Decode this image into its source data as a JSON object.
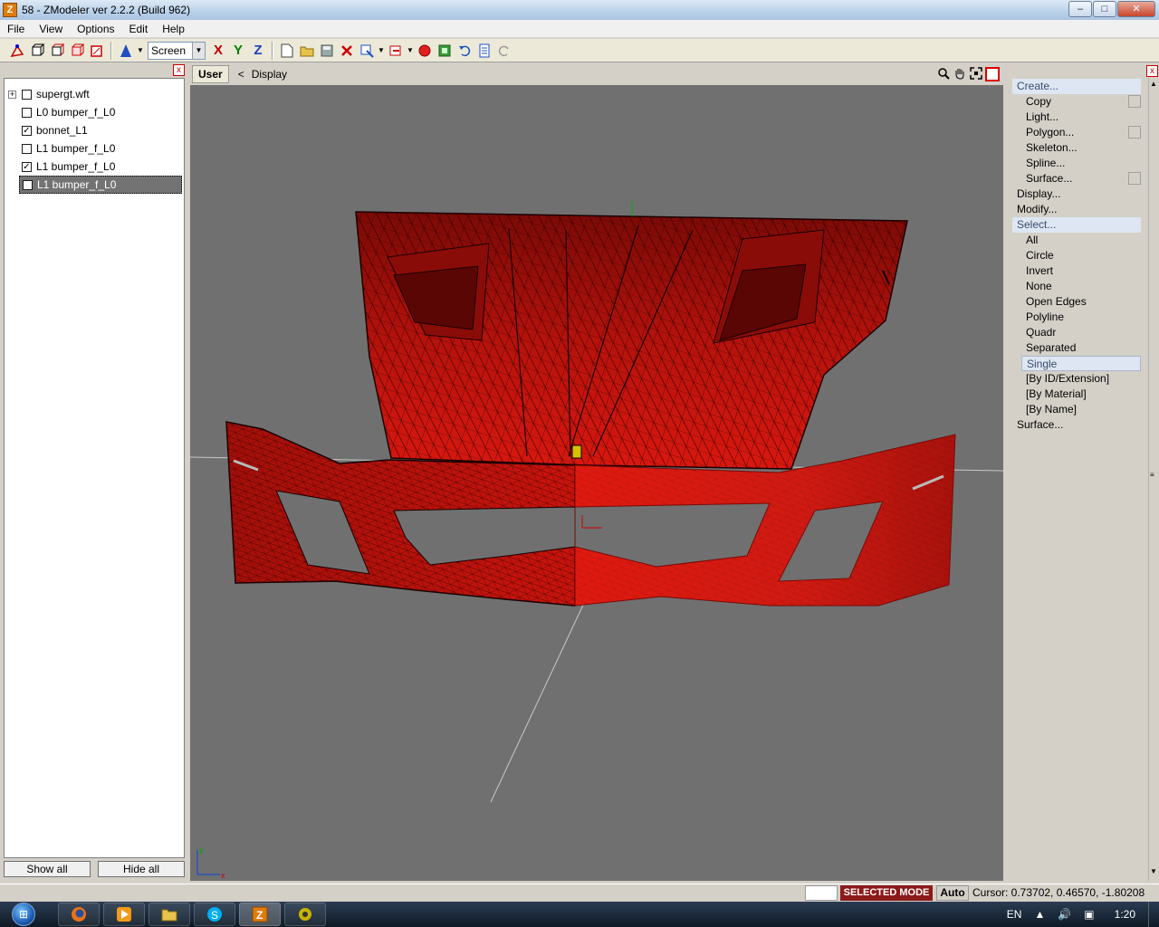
{
  "window": {
    "title": "58 - ZModeler ver 2.2.2 (Build 962)",
    "icon_letter": "Z",
    "controls": {
      "minimize": "–",
      "maximize": "□",
      "close": "✕"
    }
  },
  "menu": [
    {
      "label": "File"
    },
    {
      "label": "View"
    },
    {
      "label": "Options"
    },
    {
      "label": "Edit"
    },
    {
      "label": "Help"
    }
  ],
  "toolbar": {
    "mode_select": "Screen",
    "axis_x": "X",
    "axis_y": "Y",
    "axis_z": "Z"
  },
  "left_panel": {
    "close": "x",
    "items": [
      {
        "label": "supergt.wft",
        "expander": "+",
        "checked": false
      },
      {
        "label": "L0 bumper_f_L0",
        "checked": false
      },
      {
        "label": "bonnet_L1",
        "checked": true
      },
      {
        "label": "L1 bumper_f_L0",
        "checked": false
      },
      {
        "label": "L1 bumper_f_L0",
        "checked": true
      },
      {
        "label": "L1 bumper_f_L0",
        "checked": true,
        "selected": true
      }
    ],
    "check_mark": "✓",
    "show_all": "Show all",
    "hide_all": "Hide all"
  },
  "viewport": {
    "tab": "User",
    "back": "<",
    "display": "Display",
    "mesh_color": "#c8140c",
    "background": "#707070",
    "axis_x_label": "x",
    "axis_y_label": "y"
  },
  "right_panel": {
    "close": "x",
    "create": "Create...",
    "copy": "Copy",
    "light": "Light...",
    "polygon": "Polygon...",
    "skeleton": "Skeleton...",
    "spline": "Spline...",
    "surface_create": "Surface...",
    "display": "Display...",
    "modify": "Modify...",
    "select": "Select...",
    "select_all": "All",
    "circle": "Circle",
    "invert": "Invert",
    "none": "None",
    "open_edges": "Open Edges",
    "polyline": "Polyline",
    "quadr": "Quadr",
    "separated": "Separated",
    "single": "Single",
    "by_id": "[By ID/Extension]",
    "by_material": "[By Material]",
    "by_name": "[By Name]",
    "surface": "Surface..."
  },
  "status": {
    "mode": "SELECTED MODE",
    "auto": "Auto",
    "cursor": "Cursor: 0.73702, 0.46570, -1.80208"
  },
  "taskbar": {
    "language": "EN",
    "clock": "1:20"
  }
}
